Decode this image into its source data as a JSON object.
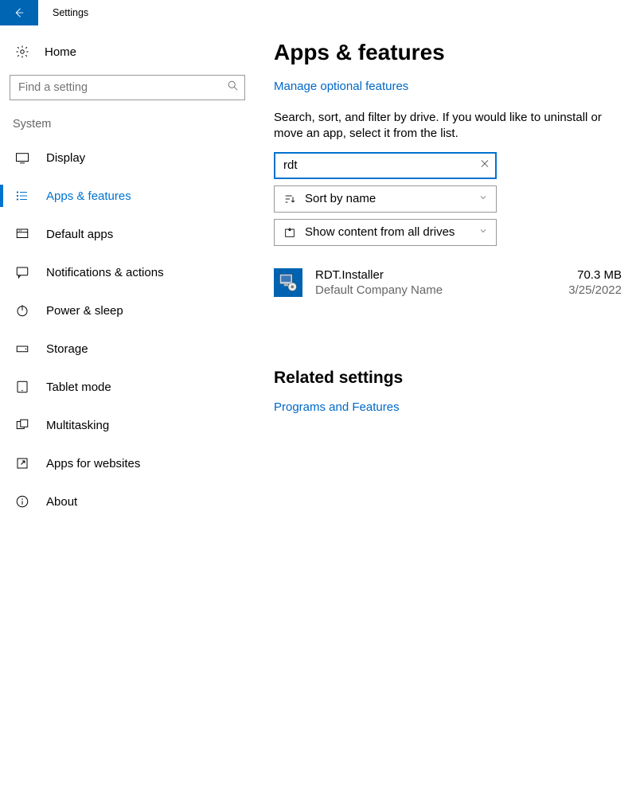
{
  "window": {
    "title": "Settings"
  },
  "sidebar": {
    "home_label": "Home",
    "search_placeholder": "Find a setting",
    "category": "System",
    "items": [
      {
        "label": "Display"
      },
      {
        "label": "Apps & features",
        "active": true
      },
      {
        "label": "Default apps"
      },
      {
        "label": "Notifications & actions"
      },
      {
        "label": "Power & sleep"
      },
      {
        "label": "Storage"
      },
      {
        "label": "Tablet mode"
      },
      {
        "label": "Multitasking"
      },
      {
        "label": "Apps for websites"
      },
      {
        "label": "About"
      }
    ]
  },
  "main": {
    "title": "Apps & features",
    "manage_link": "Manage optional features",
    "intro": "Search, sort, and filter by drive. If you would like to uninstall or move an app, select it from the list.",
    "search_value": "rdt",
    "sort_label": "Sort by name",
    "filter_label": "Show content from all drives",
    "apps": [
      {
        "name": "RDT.Installer",
        "company": "Default Company Name",
        "size": "70.3 MB",
        "date": "3/25/2022"
      }
    ],
    "related_heading": "Related settings",
    "related_link": "Programs and Features"
  }
}
